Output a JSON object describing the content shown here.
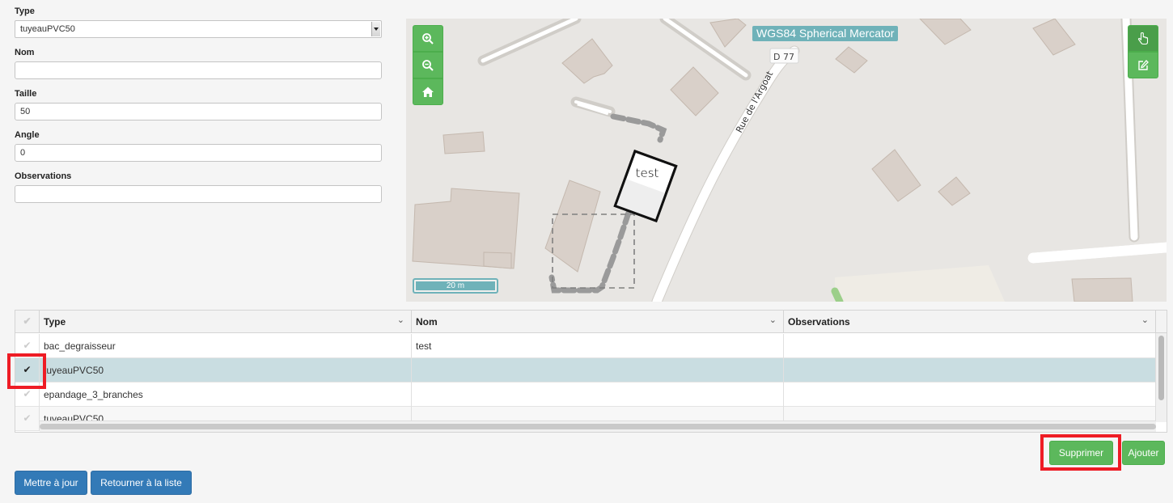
{
  "form": {
    "type_label": "Type",
    "type_value": "tuyeauPVC50",
    "nom_label": "Nom",
    "nom_value": "",
    "taille_label": "Taille",
    "taille_value": "50",
    "angle_label": "Angle",
    "angle_value": "0",
    "observations_label": "Observations",
    "observations_value": ""
  },
  "map": {
    "projection_label": "WGS84 Spherical Mercator",
    "road_ref": "D 77",
    "road_name": "Rue de l'Argoat",
    "feature_label": "test",
    "scale_label": "20 m",
    "controls": {
      "zoom_in_icon": "zoom-in-icon",
      "zoom_out_icon": "zoom-out-icon",
      "home_icon": "home-icon",
      "select_icon": "hand-pointer-icon",
      "edit_icon": "edit-icon"
    },
    "colors": {
      "button_green": "#5cb85c",
      "label_teal": "#6fb2b9",
      "building": "#d9d0c9"
    }
  },
  "grid": {
    "columns": [
      "Type",
      "Nom",
      "Observations"
    ],
    "rows": [
      {
        "type": "bac_degraisseur",
        "nom": "test",
        "observations": "",
        "selected": false
      },
      {
        "type": "tuyeauPVC50",
        "nom": "",
        "observations": "",
        "selected": true
      },
      {
        "type": "epandage_3_branches",
        "nom": "",
        "observations": "",
        "selected": false
      },
      {
        "type": "tuyeauPVC50",
        "nom": "",
        "observations": "",
        "selected": false
      }
    ]
  },
  "actions": {
    "supprimer": "Supprimer",
    "ajouter": "Ajouter",
    "mettre_a_jour": "Mettre à jour",
    "retourner": "Retourner à la liste"
  }
}
